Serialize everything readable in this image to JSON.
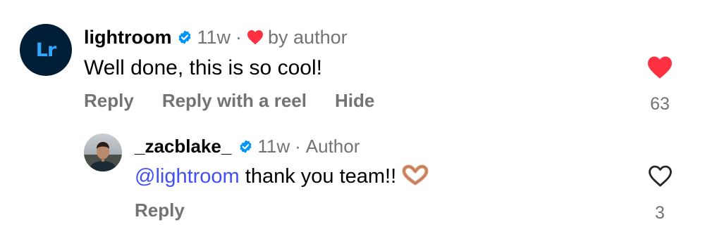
{
  "comment": {
    "avatar_text": "Lr",
    "username": "lightroom",
    "time": "11w",
    "separator": "·",
    "liked_by_author_label": "by author",
    "text": "Well done, this is so cool!",
    "actions": {
      "reply": "Reply",
      "reply_with_reel": "Reply with a reel",
      "hide": "Hide"
    },
    "like_count": "63",
    "liked": true
  },
  "reply": {
    "username": "_zacblake_",
    "time": "11w",
    "separator": "·",
    "author_badge": "Author",
    "mention": "@lightroom",
    "text": " thank you team!!",
    "emoji_icon": "heart-hands-emoji",
    "actions": {
      "reply": "Reply"
    },
    "like_count": "3",
    "liked": false
  },
  "colors": {
    "verified_blue": "#0095f6",
    "like_red": "#ff3040",
    "mention_blue": "#4150f7",
    "meta_gray": "#737373",
    "lightroom_bg": "#001e36",
    "lightroom_fg": "#31a8ff"
  }
}
